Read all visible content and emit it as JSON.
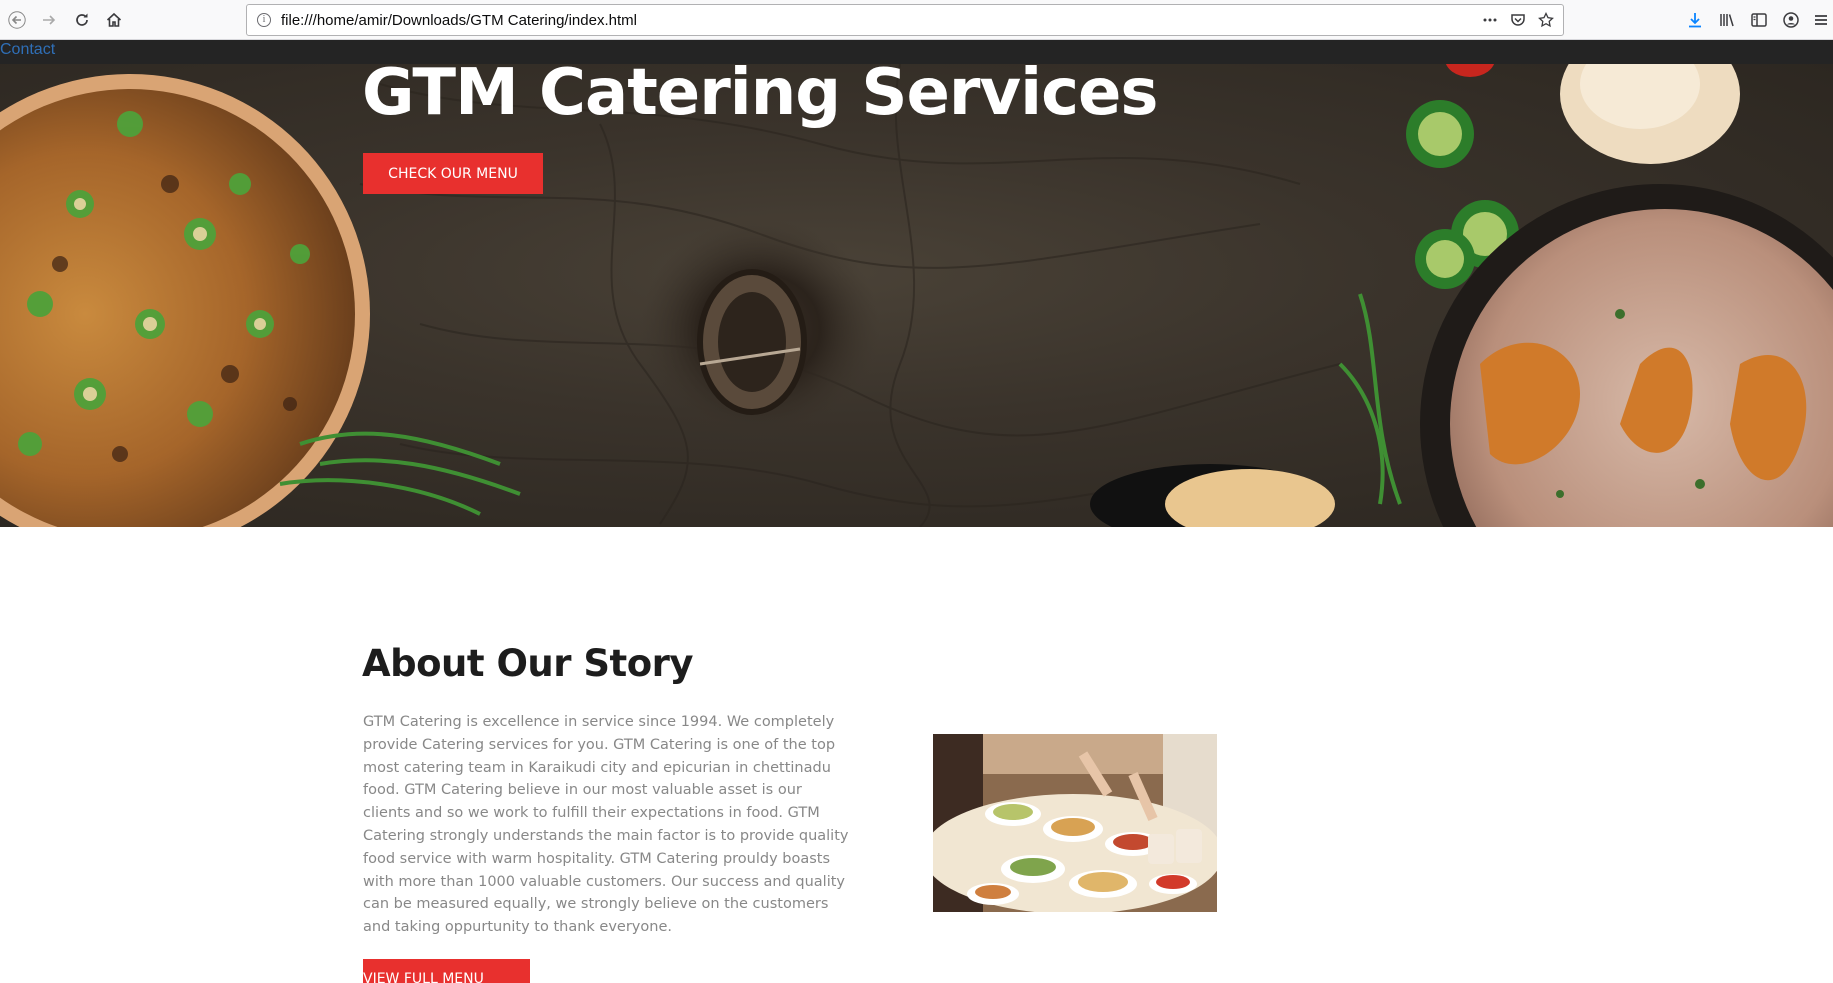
{
  "browser": {
    "url": "file:///home/amir/Downloads/GTM Catering/index.html",
    "icons": [
      "back-icon",
      "forward-icon",
      "reload-icon",
      "home-icon",
      "info-icon",
      "more-icon",
      "pocket-icon",
      "bookmark-star-icon",
      "download-icon",
      "library-icon",
      "sidebar-icon",
      "account-icon",
      "menu-icon"
    ]
  },
  "nav": {
    "contact_label": "Contact"
  },
  "hero": {
    "title": "GTM Catering Services",
    "button_label": "CHECK OUR MENU"
  },
  "about": {
    "title": "About Our Story",
    "body": "GTM Catering is excellence in service since 1994. We completely provide Catering services for you. GTM Catering is one of the top most catering team in Karaikudi city and epicurian in chettinadu food. GTM Catering believe in our most valuable asset is our clients and so we work to fulfill their expectations in food. GTM Catering strongly understands the main factor is to provide quality food service with warm hospitality. GTM Catering prouldy boasts with more than 1000 valuable customers. Our success and quality can be measured equally, we strongly believe on the customers and taking oppurtunity to thank everyone.",
    "button_label": "VIEW FULL MENU"
  },
  "colors": {
    "accent": "#e8302e",
    "nav_bg": "#242424",
    "link": "#2f6fb7"
  }
}
